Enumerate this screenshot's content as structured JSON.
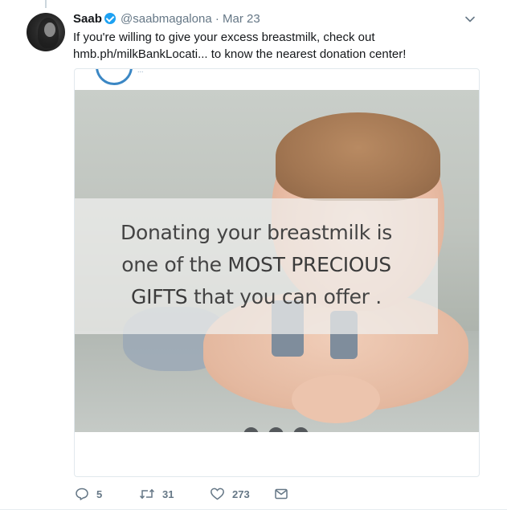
{
  "tweet": {
    "author_name": "Saab",
    "handle": "@saabmagalona",
    "separator": "·",
    "date": "Mar 23",
    "text_line1": "If you're willing to give your excess breastmilk, check out",
    "text_link": "hmb.ph/milkBankLocati...",
    "text_line2_rest": " to know the nearest donation center!"
  },
  "card": {
    "logo_text": "...",
    "quote_line1": "Donating your breastmilk is",
    "quote_line2_a": "one of the ",
    "quote_line2_b": "MOST PRECIOUS",
    "quote_line3_a": "GIFTS",
    "quote_line3_b": " that you can offer ."
  },
  "actions": {
    "replies": "5",
    "retweets": "31",
    "likes": "273"
  },
  "colors": {
    "verified": "#1da1f2",
    "muted": "#657786",
    "link_text": "#14171a"
  },
  "icons": [
    "caret-down-icon",
    "verified-icon",
    "reply-icon",
    "retweet-icon",
    "like-icon",
    "direct-message-icon"
  ]
}
